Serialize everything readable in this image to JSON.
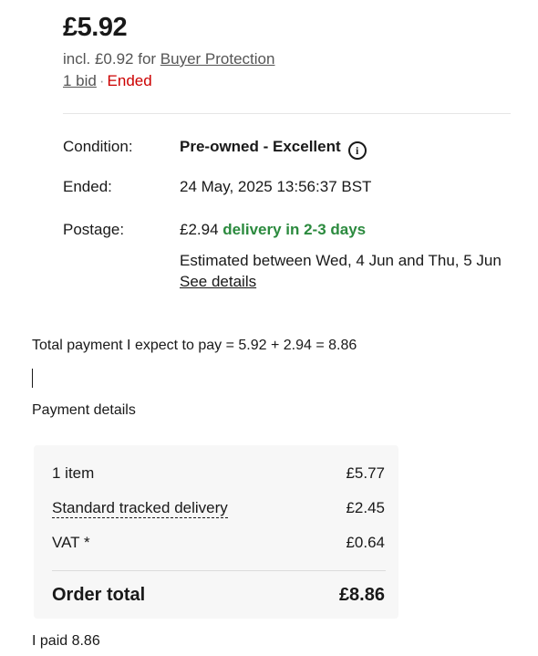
{
  "listing": {
    "price": "£5.92",
    "incl_prefix": "incl. £0.92 for ",
    "buyer_protection_link": "Buyer Protection",
    "bids_link": "1 bid",
    "separator": "·",
    "status": "Ended"
  },
  "details": {
    "condition_label": "Condition:",
    "condition_value": "Pre-owned - Excellent",
    "ended_label": "Ended:",
    "ended_value": "24 May, 2025 13:56:37 BST",
    "postage_label": "Postage:",
    "postage_price": "£2.94",
    "postage_delivery": "delivery in 2-3 days",
    "estimated": "Estimated between Wed, 4 Jun and Thu, 5 Jun",
    "see_details": "See details"
  },
  "notes": {
    "total_expected": "Total payment I expect to pay = 5.92 + 2.94 = 8.86",
    "payment_details": "Payment details",
    "paid": "I paid 8.86"
  },
  "payment": {
    "items_label": "1 item",
    "items_value": "£5.77",
    "delivery_label": "Standard tracked delivery",
    "delivery_value": "£2.45",
    "vat_label": "VAT *",
    "vat_value": "£0.64",
    "total_label": "Order total",
    "total_value": "£8.86"
  },
  "colors": {
    "ended": "#cc0000",
    "delivery_green": "#2b8a3e",
    "card_bg": "#f7f7f7"
  },
  "icons": [
    "info-icon"
  ]
}
